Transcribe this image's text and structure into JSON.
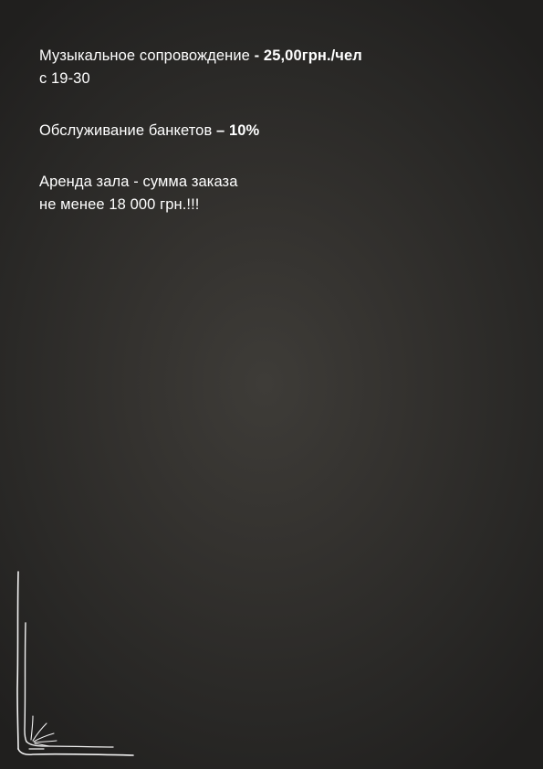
{
  "music": {
    "label": "Музыкальное сопровождение",
    "price": " - 25,00грн./чел",
    "time": "с 19-30"
  },
  "service": {
    "label": "Обслуживание банкетов",
    "price": " – 10%"
  },
  "rent": {
    "line1": "Аренда зала - сумма заказа",
    "line2": "не менее 18 000 грн.!!!"
  },
  "colors": {
    "background": "#2c2a28",
    "text": "#ffffff"
  }
}
